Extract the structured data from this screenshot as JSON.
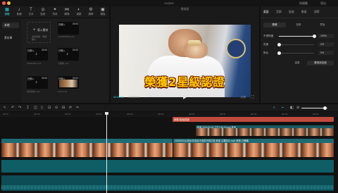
{
  "window": {
    "title": "202500",
    "right_a": "快捷鍵",
    "right_b": "導出"
  },
  "toolbar": {
    "items": [
      {
        "icon": "▦",
        "label": "媒體"
      },
      {
        "icon": "♪",
        "label": "音頻"
      },
      {
        "icon": "T",
        "label": "文本"
      },
      {
        "icon": "◎",
        "label": "貼紙"
      },
      {
        "icon": "✦",
        "label": "特效"
      },
      {
        "icon": "⋈",
        "label": "轉場"
      },
      {
        "icon": "◐",
        "label": "濾鏡"
      },
      {
        "icon": "⚙",
        "label": "調節"
      },
      {
        "icon": "▣",
        "label": "模板"
      }
    ]
  },
  "library": {
    "side_items": [
      "本地",
      "素材庫"
    ],
    "import": {
      "plus": "+",
      "label": "導入素材",
      "sub": "支持視頻、音頻、圖片"
    },
    "media": [
      {
        "badge": "已導入",
        "dur": "00:00",
        "caption": "1234567890.mp3"
      },
      {
        "badge": "已導入",
        "dur": "00:00",
        "caption": "20250304.mp3"
      },
      {
        "badge": "已導入",
        "dur": "00:00",
        "caption": "大獨角.mp3"
      },
      {
        "badge": "已導入",
        "dur": "00:00",
        "caption": "你的聲音.mp3"
      },
      {
        "badge": "已導入",
        "dur": "00:00",
        "caption": "大獨角.mp3"
      },
      {
        "badge": "已導入",
        "dur": "00:02",
        "caption": "1234.mp4"
      }
    ],
    "note_icon": "♪"
  },
  "player": {
    "title": "播放器",
    "caption": "榮獲2星級認證",
    "time_current": "00:00:00",
    "time_duration": "00:00:00",
    "play_icon": "▶",
    "ratio_label": "比例",
    "fullscreen_icon": "⛶"
  },
  "inspector": {
    "tabs": [
      "畫面",
      "音頻",
      "變速",
      "動畫",
      "調節"
    ],
    "sub_tabs": [
      "基礎",
      "摳像",
      "蒙版"
    ],
    "props": [
      {
        "label": "不透明度",
        "value": "100%",
        "level": 1.0
      },
      {
        "label": "亮度",
        "value": "0%",
        "level": 0.0
      },
      {
        "label": "對比",
        "value": "0%",
        "level": 0.0
      }
    ],
    "reset_label": "重置",
    "apply_all_label": "應用到全部"
  },
  "timeline": {
    "tools": [
      "↖",
      "↶",
      "↷",
      "⌶",
      "◫",
      "▯",
      "⊡",
      "⊙",
      "⊟",
      "⟳",
      "✂"
    ],
    "right_tools": [
      "⌕",
      "⌁",
      "◧",
      "⊖"
    ],
    "ticks": [
      "00:00",
      "|00:05",
      "|00:10",
      "|00:15",
      "|00:20",
      "|00:25",
      "|00:30",
      "|00:35",
      "|00:40",
      "|00:45",
      "|00:50"
    ],
    "text_clip": "榮獲2星級認證",
    "overlay_clip": "動畫 2023-03-04 下午2.35.03.png  其他",
    "clip_a": "",
    "clip_b": "20250304以熱水沖泡及冷泡的不同口感 其他 主要影片.mp4  其他  已解鎖",
    "audio": ""
  },
  "colors": {
    "accent": "#2fd5e7",
    "caption": "#ffcc00",
    "text_clip": "#c04a3e",
    "clip": "#1e6b74"
  }
}
